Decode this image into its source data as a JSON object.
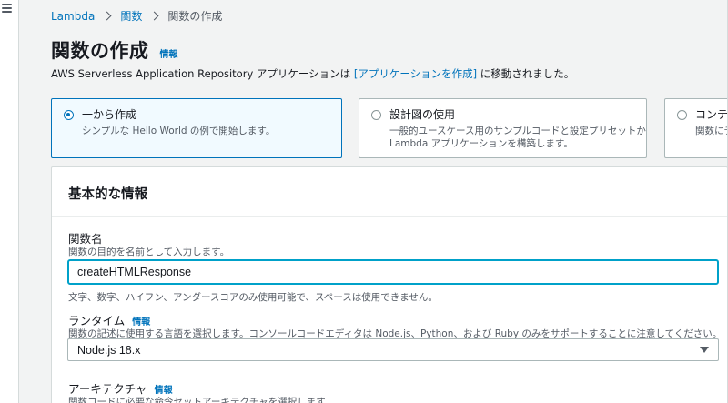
{
  "breadcrumb": {
    "items": [
      "Lambda",
      "関数"
    ],
    "current": "関数の作成"
  },
  "page": {
    "title": "関数の作成",
    "info_link": "情報",
    "notice_prefix": "AWS Serverless Application Repository アプリケーションは ",
    "notice_link": "[アプリケーションを作成]",
    "notice_suffix": " に移動されました。"
  },
  "options": [
    {
      "title": "一から作成",
      "description": [
        "シンプルな Hello World の例で開始します。"
      ],
      "selected": true
    },
    {
      "title": "設計図の使用",
      "description": [
        "一般的ユースケース用のサンプルコードと設定プリセットから",
        "Lambda アプリケーションを構築します。"
      ],
      "selected": false
    },
    {
      "title": "コンテナ",
      "description": [
        "関数にデ"
      ],
      "selected": false
    }
  ],
  "basic_info": {
    "title": "基本的な情報",
    "function_name": {
      "label": "関数名",
      "description": "関数の目的を名前として入力します。",
      "value": "createHTMLResponse",
      "constraint": "文字、数字、ハイフン、アンダースコアのみ使用可能で、スペースは使用できません。"
    },
    "runtime": {
      "label": "ランタイム",
      "info": "情報",
      "description": "関数の記述に使用する言語を選択します。コンソールコードエディタは Node.js、Python、および Ruby のみをサポートすることに注意してください。",
      "value": "Node.js 18.x"
    },
    "architecture": {
      "label": "アーキテクチャ",
      "info": "情報",
      "description": "関数コードに必要な命令セットアーキテクチャを選択します。"
    }
  },
  "colors": {
    "link": "#0073bb",
    "selected_border": "#0073bb",
    "selected_bg": "#f1faff",
    "focus_border": "#00a1c9"
  }
}
